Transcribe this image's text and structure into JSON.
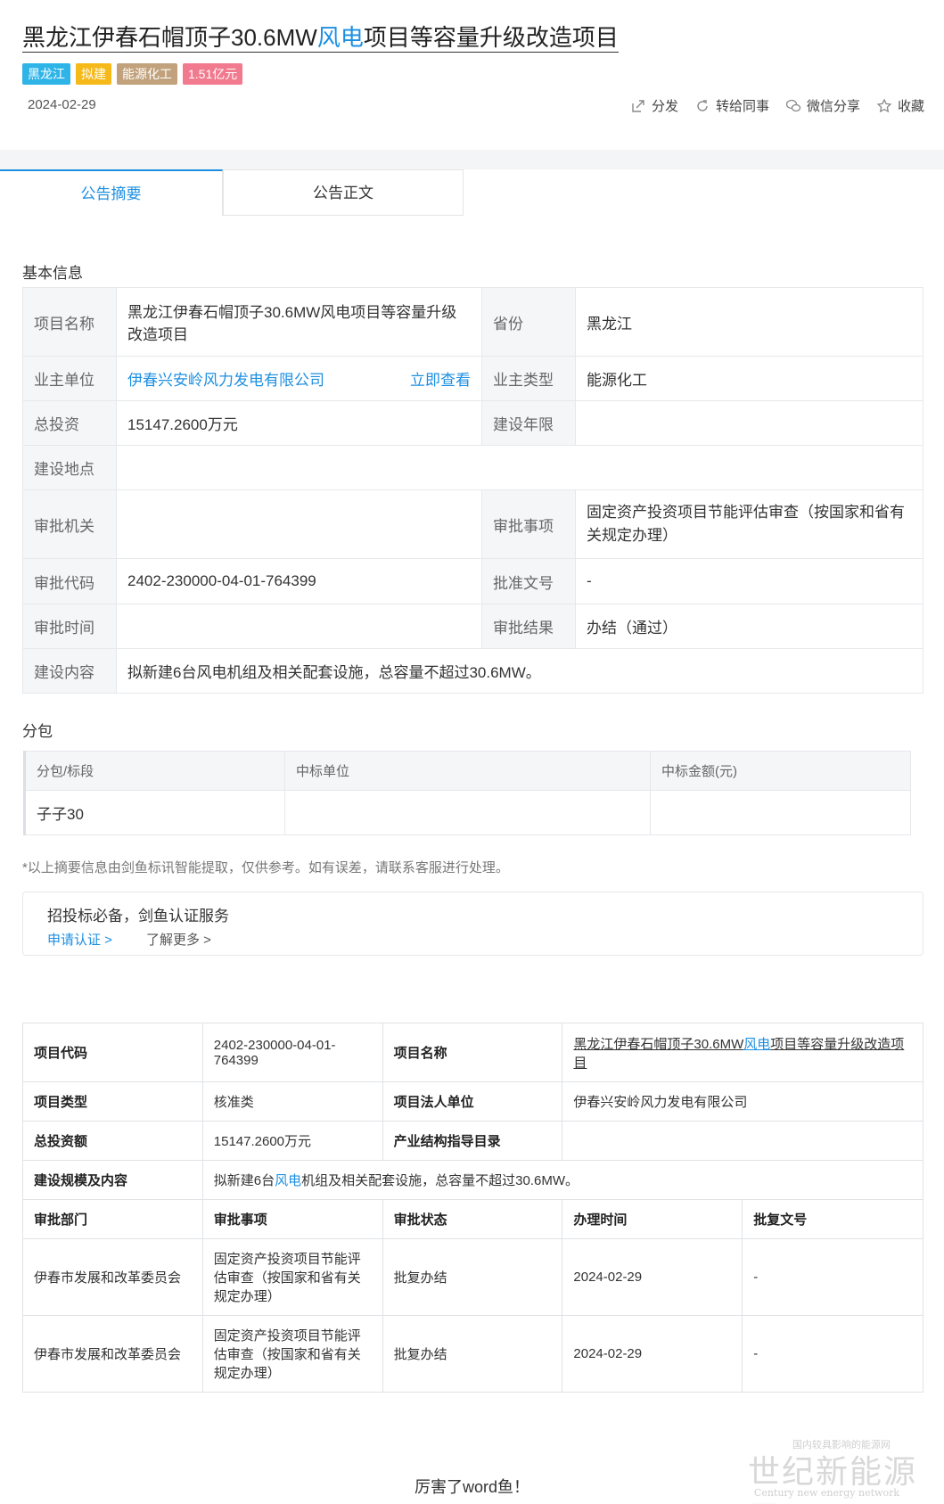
{
  "header": {
    "title_pre": "黑龙江伊春石帽顶子30.6MW",
    "title_hl": "风电",
    "title_post": "项目等容量升级改造项目",
    "tags": [
      {
        "label": "黑龙江",
        "color": "#2fb4e8"
      },
      {
        "label": "拟建",
        "color": "#f5b91a"
      },
      {
        "label": "能源化工",
        "color": "#c1a27c"
      },
      {
        "label": "1.51亿元",
        "color": "#f27a8e"
      }
    ],
    "date": "2024-02-29",
    "actions": {
      "share": "分发",
      "forward": "转给同事",
      "wechat": "微信分享",
      "favorite": "收藏"
    }
  },
  "tabs": {
    "summary": "公告摘要",
    "body": "公告正文"
  },
  "basic_info": {
    "section_title": "基本信息",
    "project_name_k": "项目名称",
    "project_name_v": "黑龙江伊春石帽顶子30.6MW风电项目等容量升级改造项目",
    "province_k": "省份",
    "province_v": "黑龙江",
    "owner_k": "业主单位",
    "owner_v": "伊春兴安岭风力发电有限公司",
    "owner_view": "立即查看",
    "owner_type_k": "业主类型",
    "owner_type_v": "能源化工",
    "investment_k": "总投资",
    "investment_v": "15147.2600万元",
    "period_k": "建设年限",
    "period_v": "",
    "location_k": "建设地点",
    "location_v": "",
    "authority_k": "审批机关",
    "authority_v": "",
    "matter_k": "审批事项",
    "matter_v": "固定资产投资项目节能评估审查（按国家和省有关规定办理）",
    "code_k": "审批代码",
    "code_v": "2402-230000-04-01-764399",
    "doc_no_k": "批准文号",
    "doc_no_v": "-",
    "time_k": "审批时间",
    "time_v": "",
    "result_k": "审批结果",
    "result_v": "办结（通过）",
    "content_k": "建设内容",
    "content_v": "拟新建6台风电机组及相关配套设施，总容量不超过30.6MW。"
  },
  "packages": {
    "section_title": "分包",
    "headers": [
      "分包/标段",
      "中标单位",
      "中标金额(元)"
    ],
    "rows": [
      [
        "子子30",
        "",
        ""
      ]
    ]
  },
  "note": "*以上摘要信息由剑鱼标讯智能提取，仅供参考。如有误差，请联系客服进行处理。",
  "promo": {
    "title": "招投标必备，剑鱼认证服务",
    "apply": "申请认证 >",
    "more": "了解更多 >"
  },
  "detail": {
    "code_k": "项目代码",
    "code_v": "2402-230000-04-01-764399",
    "name_k": "项目名称",
    "name_pre": "黑龙江伊春石帽顶子30.6MW",
    "name_hl": "风电",
    "name_post": "项目等容量升级改造项目",
    "type_k": "项目类型",
    "type_v": "核准类",
    "legal_k": "项目法人单位",
    "legal_v": "伊春兴安岭风力发电有限公司",
    "invest_k": "总投资额",
    "invest_v": "15147.2600万元",
    "catalog_k": "产业结构指导目录",
    "catalog_v": "",
    "scale_k": "建设规模及内容",
    "scale_pre": "拟新建6台",
    "scale_hl": "风电",
    "scale_post": "机组及相关配套设施，总容量不超过30.6MW。",
    "approval_headers": [
      "审批部门",
      "审批事项",
      "审批状态",
      "办理时间",
      "批复文号"
    ],
    "approvals": [
      [
        "伊春市发展和改革委员会",
        "固定资产投资项目节能评估审查（按国家和省有关规定办理）",
        "批复办结",
        "2024-02-29",
        "-"
      ],
      [
        "伊春市发展和改革委员会",
        "固定资产投资项目节能评估审查（按国家和省有关规定办理）",
        "批复办结",
        "2024-02-29",
        "-"
      ]
    ]
  },
  "footer": "厉害了word鱼！",
  "watermark": {
    "main": "世纪新能源网",
    "top": "国内较具影响的能源网",
    "bottom": "Century new energy network"
  }
}
